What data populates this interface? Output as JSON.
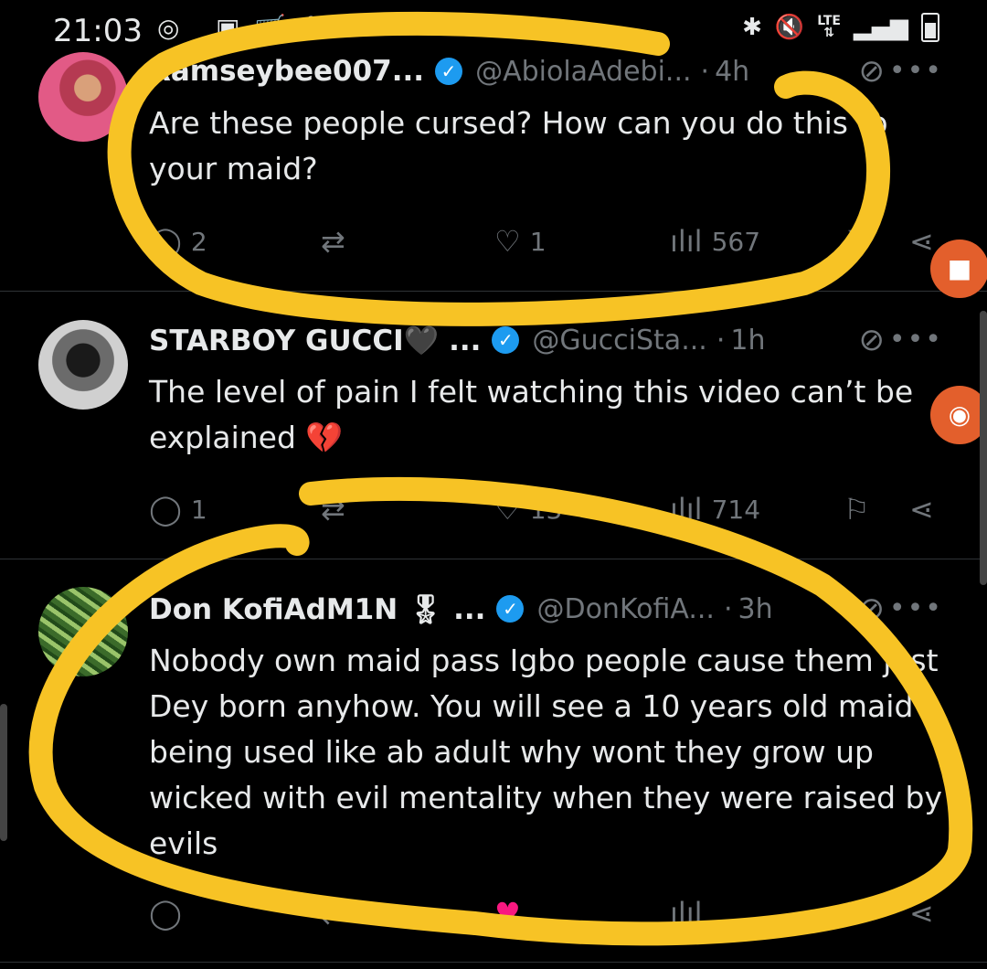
{
  "status_bar": {
    "time": "21:03",
    "network": "LTE"
  },
  "tweets": [
    {
      "name": "Ramseybee007...",
      "handle": "@AbiolaAdebi...",
      "separator": "·",
      "age": "4h",
      "text": "Are these people cursed? How can you do this to your maid?",
      "replies": "2",
      "reposts": "",
      "likes": "1",
      "views": "567"
    },
    {
      "name": "STARBOY GUCCI🖤 ...",
      "handle": "@GucciSta...",
      "separator": "·",
      "age": "1h",
      "text": "The level of pain I felt watching this video can’t be explained 💔",
      "replies": "1",
      "reposts": "",
      "likes": "13",
      "views": "714"
    },
    {
      "name": "Don KofiAdM1N 🎖 ...",
      "handle": "@DonKofiA...",
      "separator": "·",
      "age": "3h",
      "text": "Nobody own maid pass Igbo people cause them just Dey born anyhow. You will see a 10 years old maid being used like ab adult why wont they grow up wicked with evil mentality when they were raised by evils",
      "replies": "",
      "reposts": "",
      "likes": "",
      "views": ""
    }
  ],
  "icons": {
    "reply": "speech-bubble-icon",
    "repost": "repost-arrows-icon",
    "like": "heart-icon",
    "views": "bar-chart-icon",
    "bookmark": "bookmark-icon",
    "share": "share-icon",
    "grok": "grok-slash-icon",
    "more": "more-dots-icon"
  },
  "colors": {
    "background": "#000000",
    "text": "#e7e9ea",
    "muted": "#71767b",
    "verified": "#1d9bf0",
    "annotation": "#f7c325",
    "overlay_button": "#e35f2c"
  }
}
